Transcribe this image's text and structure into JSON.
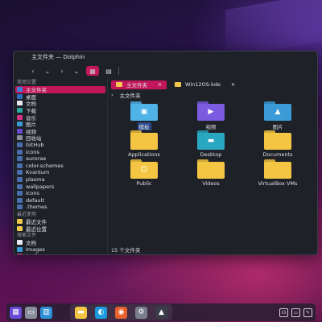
{
  "window": {
    "title": "主文件夹 — Dolphin"
  },
  "toolbar": {
    "back_glyph": "‹",
    "back_menu_glyph": "⌄",
    "forward_glyph": "›",
    "view_icons_glyph": "▦",
    "view_compact_glyph": "▤"
  },
  "sidebar": {
    "places_title": "常用位置",
    "places": [
      {
        "label": "主文件夹",
        "color": "#3b82d6",
        "selected": true
      },
      {
        "label": "桌面",
        "color": "#2f6fc2"
      },
      {
        "label": "文档",
        "color": "#e8eaf2"
      },
      {
        "label": "下载",
        "color": "#2aa7a0"
      },
      {
        "label": "音乐",
        "color": "#d6338a"
      },
      {
        "label": "图片",
        "color": "#3b9bd6"
      },
      {
        "label": "视频",
        "color": "#6a4bd6"
      },
      {
        "label": "回收站",
        "color": "#8a8f9c"
      },
      {
        "label": "GitHub",
        "color": "#4a6fb0"
      },
      {
        "label": "icons",
        "color": "#4a6fb0"
      },
      {
        "label": "aurorae",
        "color": "#4a6fb0"
      },
      {
        "label": "color-schemes",
        "color": "#4a6fb0"
      },
      {
        "label": "Kvantum",
        "color": "#4a6fb0"
      },
      {
        "label": "plasma",
        "color": "#4a6fb0"
      },
      {
        "label": "wallpapers",
        "color": "#4a6fb0"
      },
      {
        "label": "icons",
        "color": "#4a6fb0"
      },
      {
        "label": "default",
        "color": "#4a6fb0"
      },
      {
        "label": ".themes",
        "color": "#4a6fb0"
      }
    ],
    "recent_title": "最近使用",
    "recent": [
      {
        "label": "最近文件",
        "color": "#f2c94c"
      },
      {
        "label": "最近位置",
        "color": "#f2c94c"
      }
    ],
    "search_title": "搜索文件",
    "search": [
      {
        "label": "文档",
        "color": "#e8eaf2"
      },
      {
        "label": "Images",
        "color": "#3b9bd6"
      },
      {
        "label": "Audio",
        "color": "#d6338a"
      }
    ]
  },
  "tabs": [
    {
      "label": "主文件夹",
      "active": true,
      "close": "✕"
    },
    {
      "label": "Win12OS-kde",
      "active": false,
      "close": "✕"
    }
  ],
  "breadcrumb": {
    "arrow": "›",
    "label": "主文件夹"
  },
  "files": [
    {
      "label": "模板",
      "color": "#4fb3e8",
      "glyph": "▣",
      "selected": true
    },
    {
      "label": "视频",
      "color": "#7b5be0",
      "glyph": "▶"
    },
    {
      "label": "图片",
      "color": "#3b9bd6",
      "glyph": "▲"
    },
    {
      "label": "Applications",
      "color": "#f4c542",
      "glyph": ""
    },
    {
      "label": "Desktop",
      "color": "#2aa7c0",
      "glyph": "▬"
    },
    {
      "label": "Documents",
      "color": "#f4c542",
      "glyph": ""
    },
    {
      "label": "Public",
      "color": "#f4c542",
      "glyph": "☺"
    },
    {
      "label": "Videos",
      "color": "#f4c542",
      "glyph": ""
    },
    {
      "label": "VirtualBox VMs",
      "color": "#f4c542",
      "glyph": ""
    }
  ],
  "status": {
    "count": "15 个文件夹"
  },
  "taskbar": {
    "left": [
      {
        "name": "start-menu-icon",
        "color": "#6a4bd6",
        "glyph": "▦"
      },
      {
        "name": "task-view-icon",
        "color": "#8a8f9c",
        "glyph": "▭"
      },
      {
        "name": "widgets-icon",
        "color": "#2f8fd6",
        "glyph": "▥"
      }
    ],
    "apps": [
      {
        "name": "file-manager-icon",
        "color": "#f4c542",
        "glyph": "▬"
      },
      {
        "name": "edge-browser-icon",
        "color": "#1e9be0",
        "glyph": "◐"
      },
      {
        "name": "firefox-icon",
        "color": "#e8612c",
        "glyph": "◉"
      },
      {
        "name": "settings-icon",
        "color": "#7a7f8c",
        "glyph": "⚙"
      },
      {
        "name": "store-icon",
        "color": "#3a3d47",
        "glyph": "▲"
      }
    ],
    "tray": [
      {
        "name": "headset-icon",
        "glyph": "☊"
      },
      {
        "name": "display-icon",
        "glyph": "▭"
      },
      {
        "name": "pen-icon",
        "glyph": "✎"
      }
    ]
  }
}
